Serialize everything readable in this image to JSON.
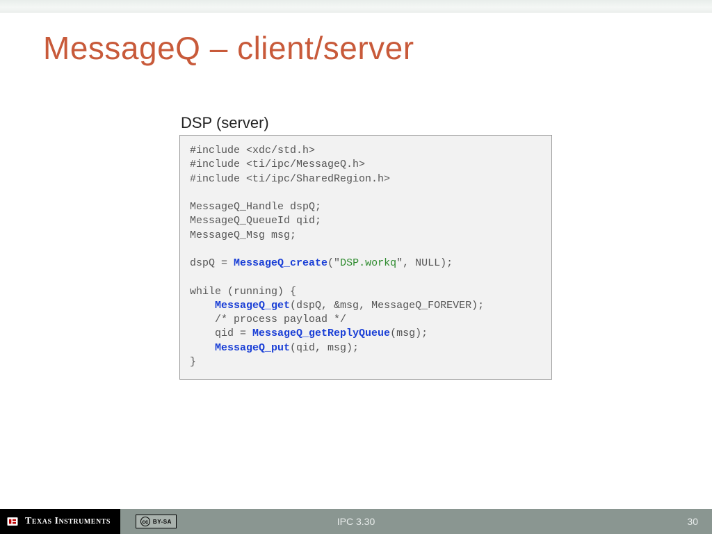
{
  "title": "MessageQ – client/server",
  "subtitle": "DSP (server)",
  "code": {
    "inc1": "#include <xdc/std.h>",
    "inc2": "#include <ti/ipc/MessageQ.h>",
    "inc3": "#include <ti/ipc/SharedRegion.h>",
    "decl1": "MessageQ_Handle dspQ;",
    "decl2": "MessageQ_QueueId qid;",
    "decl3": "MessageQ_Msg msg;",
    "assign_pre": "dspQ = ",
    "fn_create": "MessageQ_create",
    "assign_mid1": "(\"",
    "str_workq": "DSP.workq",
    "assign_post1": "\", NULL);",
    "while_open": "while (running) {",
    "indent": "    ",
    "fn_get": "MessageQ_get",
    "get_args": "(dspQ, &msg, MessageQ_FOREVER);",
    "comment": "/* process payload */",
    "qid_pre": "qid = ",
    "fn_reply": "MessageQ_getReplyQueue",
    "reply_args": "(msg);",
    "fn_put": "MessageQ_put",
    "put_args": "(qid, msg);",
    "while_close": "}"
  },
  "footer": {
    "brand": "Texas Instruments",
    "cc": "BY-SA",
    "center": "IPC 3.30",
    "page": "30"
  }
}
